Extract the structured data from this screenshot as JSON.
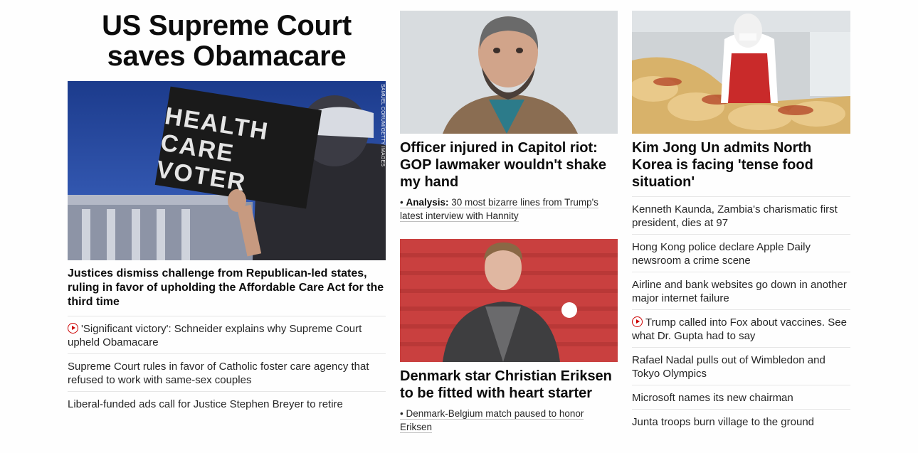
{
  "lead": {
    "headline": "US Supreme Court saves Obamacare",
    "image_credit": "SAMUEL CORUM/GETTY IMAGES",
    "sign_text": [
      "HEALTH",
      "CARE",
      "VOTER"
    ],
    "summary": "Justices dismiss challenge from Republican-led states, ruling in favor of upholding the Affordable Care Act for the third time",
    "links": [
      {
        "text": "'Significant victory': Schneider explains why Supreme Court upheld Obamacare",
        "icon": "play-icon"
      },
      {
        "text": "Supreme Court rules in favor of Catholic foster care agency that refused to work with same-sex couples"
      },
      {
        "text": "Liberal-funded ads call for Justice Stephen Breyer to retire"
      }
    ]
  },
  "middle": {
    "story1": {
      "title": "Officer injured in Capitol riot: GOP lawmaker wouldn't shake my hand",
      "related_prefix": "Analysis:",
      "related_text": "30 most bizarre lines from Trump's latest interview with Hannity"
    },
    "story2": {
      "title": "Denmark star Christian Eriksen to be fitted with heart starter",
      "related_text": "Denmark-Belgium match paused to honor Eriksen"
    }
  },
  "right": {
    "story": {
      "title": "Kim Jong Un admits North Korea is facing 'tense food situation'"
    },
    "links": [
      {
        "text": "Kenneth Kaunda, Zambia's charismatic first president, dies at 97"
      },
      {
        "text": "Hong Kong police declare Apple Daily newsroom a crime scene"
      },
      {
        "text": "Airline and bank websites go down in another major internet failure"
      },
      {
        "text": "Trump called into Fox about vaccines. See what Dr. Gupta had to say",
        "icon": "play-icon"
      },
      {
        "text": "Rafael Nadal pulls out of Wimbledon and Tokyo Olympics"
      },
      {
        "text": "Microsoft names its new chairman"
      },
      {
        "text": "Junta troops burn village to the ground"
      }
    ]
  },
  "colors": {
    "text": "#0c0c0c",
    "link_text": "#262626",
    "divider": "#e6e6e6",
    "play_red": "#cc0000"
  }
}
